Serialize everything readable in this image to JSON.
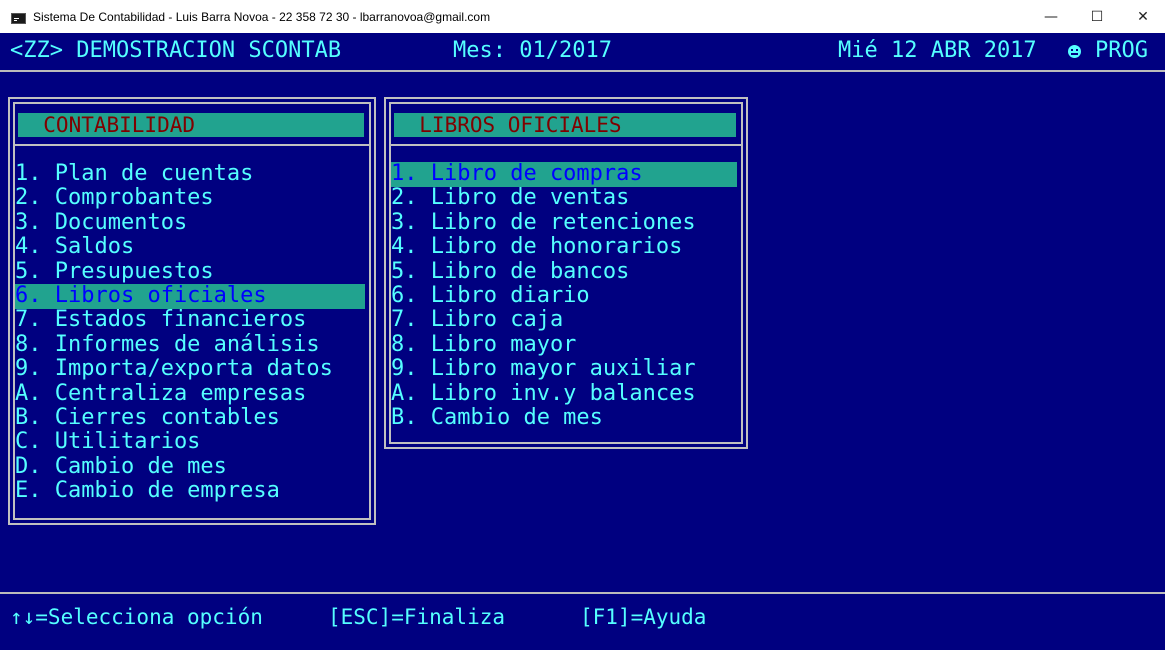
{
  "window": {
    "title": "Sistema De Contabilidad - Luis Barra Novoa - 22 358 72 30 - lbarranovoa@gmail.com",
    "minimize_glyph": "—",
    "maximize_glyph": "☐",
    "close_glyph": "✕"
  },
  "status": {
    "company": "<ZZ> DEMOSTRACION SCONTAB",
    "month": "Mes: 01/2017",
    "date": "Mié 12 ABR 2017",
    "user": "PROG"
  },
  "contabilidad_menu": {
    "title": "  CONTABILIDAD",
    "items": [
      {
        "label": "1. Plan de cuentas"
      },
      {
        "label": "2. Comprobantes"
      },
      {
        "label": "3. Documentos"
      },
      {
        "label": "4. Saldos"
      },
      {
        "label": "5. Presupuestos"
      },
      {
        "label": "6. Libros oficiales",
        "selected": true
      },
      {
        "label": "7. Estados financieros"
      },
      {
        "label": "8. Informes de análisis"
      },
      {
        "label": "9. Importa/exporta datos"
      },
      {
        "label": "A. Centraliza empresas"
      },
      {
        "label": "B. Cierres contables"
      },
      {
        "label": "C. Utilitarios"
      },
      {
        "label": "D. Cambio de mes"
      },
      {
        "label": "E. Cambio de empresa"
      }
    ]
  },
  "libros_menu": {
    "title": "  LIBROS OFICIALES",
    "items": [
      {
        "label": "1. Libro de compras",
        "selected": true
      },
      {
        "label": "2. Libro de ventas"
      },
      {
        "label": "3. Libro de retenciones"
      },
      {
        "label": "4. Libro de honorarios"
      },
      {
        "label": "5. Libro de bancos"
      },
      {
        "label": "6. Libro diario"
      },
      {
        "label": "7. Libro caja"
      },
      {
        "label": "8. Libro mayor"
      },
      {
        "label": "9. Libro mayor auxiliar"
      },
      {
        "label": "A. Libro inv.y balances"
      },
      {
        "label": "B. Cambio de mes"
      }
    ]
  },
  "help": {
    "select": "↑↓=Selecciona opción",
    "finish": "[ESC]=Finaliza",
    "help": "[F1]=Ayuda"
  },
  "colors": {
    "console_bg": "#000080",
    "text": "#55ffff",
    "highlight_bg": "#21a38f",
    "highlight_text": "#0000ff",
    "header_text": "#800000"
  }
}
